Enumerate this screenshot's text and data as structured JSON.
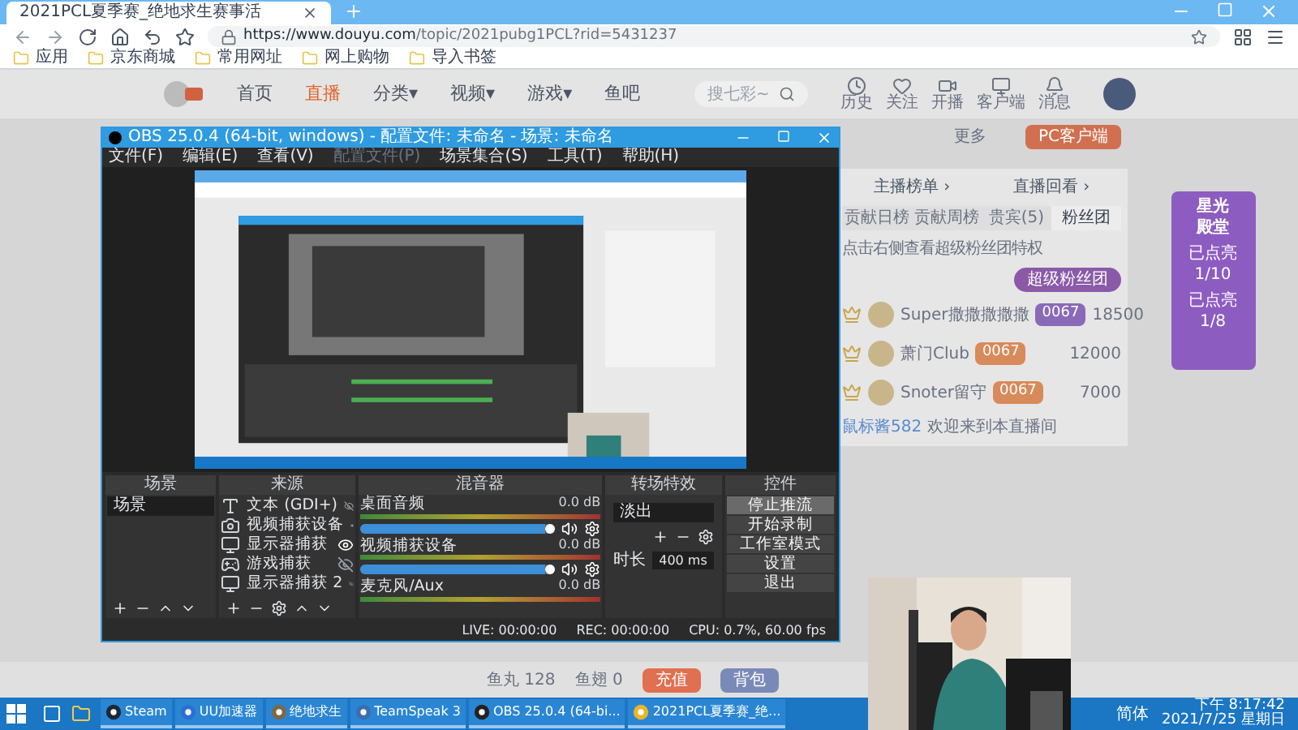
{
  "browser": {
    "tab_title": "2021PCL夏季赛_绝地求生赛事活",
    "url_host": "https://www.douyu.com",
    "url_path": "/topic/2021pubg1PCL?rid=5431237",
    "bookmarks": [
      "应用",
      "京东商城",
      "常用网址",
      "网上购物",
      "导入书签"
    ]
  },
  "page": {
    "nav": [
      {
        "label": "首页",
        "selected": false
      },
      {
        "label": "直播",
        "selected": true
      },
      {
        "label": "分类▾",
        "selected": false
      },
      {
        "label": "视频▾",
        "selected": false
      },
      {
        "label": "游戏▾",
        "selected": false
      },
      {
        "label": "鱼吧",
        "selected": false
      }
    ],
    "search": {
      "placeholder": "搜七彩~"
    },
    "header_icons": [
      "历史",
      "关注",
      "开播",
      "客户端",
      "消息"
    ],
    "more": "更多",
    "pc_client": "PC客户端",
    "rank_links": [
      "主播榜单 ›",
      "直播回看 ›"
    ],
    "rank_tabs": [
      {
        "label": "贡献日榜",
        "selected": false
      },
      {
        "label": "贡献周榜",
        "selected": false
      },
      {
        "label": "贵宾(5)",
        "selected": false
      },
      {
        "label": "粉丝团",
        "selected": true
      }
    ],
    "fan_hint": "点击右侧查看超级粉丝团特权",
    "fan_button": "超级粉丝团",
    "ranks": [
      {
        "name": "Super撒撒撒撒撒",
        "badge": "0067",
        "score": "18500"
      },
      {
        "name": "萧门Club",
        "badge": "0067",
        "score": "12000"
      },
      {
        "name": "Snoter留守",
        "badge": "0067",
        "score": "7000"
      }
    ],
    "chat": {
      "user": "鼠标酱582",
      "text": "欢迎来到本直播间"
    },
    "promo": {
      "title": "星光殿堂",
      "lines": [
        "已点亮1/10",
        "已点亮1/8"
      ]
    },
    "wallet": [
      "鱼丸 128",
      "鱼翅 0"
    ],
    "wallet_buttons": [
      "充值",
      "背包"
    ]
  },
  "obs": {
    "title": "OBS 25.0.4 (64-bit, windows) - 配置文件: 未命名 - 场景: 未命名",
    "menu": [
      {
        "label": "文件(F)",
        "disabled": false
      },
      {
        "label": "编辑(E)",
        "disabled": false
      },
      {
        "label": "查看(V)",
        "disabled": false
      },
      {
        "label": "配置文件(P)",
        "disabled": true
      },
      {
        "label": "场景集合(S)",
        "disabled": false
      },
      {
        "label": "工具(T)",
        "disabled": false
      },
      {
        "label": "帮助(H)",
        "disabled": false
      }
    ],
    "docks": [
      "场景",
      "来源",
      "混音器",
      "转场特效",
      "控件"
    ],
    "scenes": [
      {
        "label": "场景",
        "selected": true
      }
    ],
    "sources": [
      {
        "label": "文本 (GDI+)",
        "kind": "text",
        "visible": false
      },
      {
        "label": "视频捕获设备",
        "kind": "camera",
        "visible": true
      },
      {
        "label": "显示器捕获",
        "kind": "monitor",
        "visible": true
      },
      {
        "label": "游戏捕获",
        "kind": "game",
        "visible": false
      },
      {
        "label": "显示器捕获 2",
        "kind": "monitor",
        "visible": false
      }
    ],
    "mixer": [
      {
        "name": "桌面音频",
        "db": "0.0 dB",
        "level": 0.95
      },
      {
        "name": "视频捕获设备",
        "db": "0.0 dB",
        "level": 0.95
      },
      {
        "name": "麦克风/Aux",
        "db": "0.0 dB"
      }
    ],
    "transition": "淡出",
    "duration_label": "时长",
    "duration": "400 ms",
    "controls": [
      {
        "label": "停止推流",
        "selected": true
      },
      {
        "label": "开始录制",
        "selected": false
      },
      {
        "label": "工作室模式",
        "selected": false
      },
      {
        "label": "设置",
        "selected": false
      },
      {
        "label": "退出",
        "selected": false
      }
    ],
    "status": [
      "LIVE: 00:00:00",
      "REC: 00:00:00",
      "CPU: 0.7%, 60.00 fps"
    ]
  },
  "taskbar": {
    "apps": [
      {
        "label": "Steam",
        "kind": "steam"
      },
      {
        "label": "UU加速器",
        "kind": "uu"
      },
      {
        "label": "绝地求生",
        "kind": "game"
      },
      {
        "label": "TeamSpeak 3",
        "kind": "ts"
      },
      {
        "label": "OBS 25.0.4 (64-bi...",
        "kind": "obs"
      },
      {
        "label": "2021PCL夏季赛_绝...",
        "kind": "chrome"
      }
    ],
    "lang": "简体",
    "time": "下午 8:17:42",
    "date": "2021/7/25 星期日"
  }
}
